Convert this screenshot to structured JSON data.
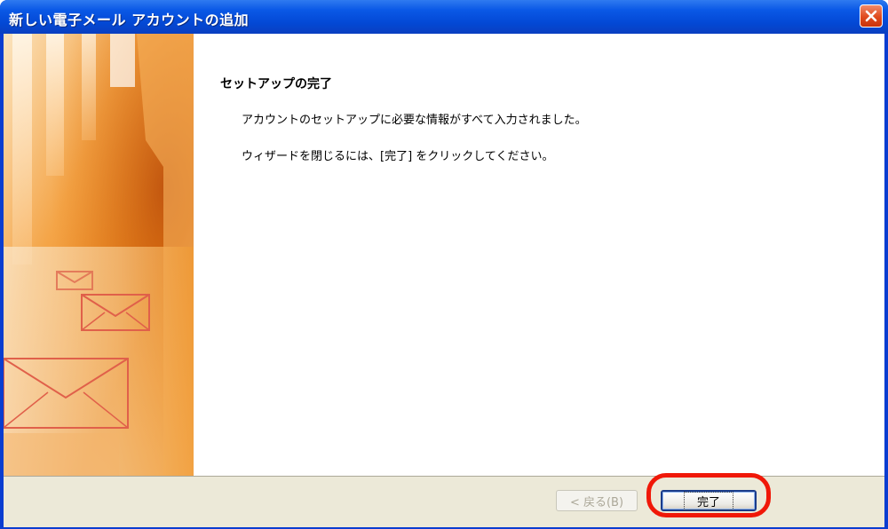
{
  "window": {
    "title": "新しい電子メール アカウントの追加",
    "title_bar_color": "#0a58e6",
    "close_icon": "close-icon"
  },
  "content": {
    "heading": "セットアップの完了",
    "message_line1": "アカウントのセットアップに必要な情報がすべて入力されました。",
    "message_line2": "ウィザードを閉じるには、[完了] をクリックしてください。"
  },
  "buttons": {
    "back_label": "< 戻る(B)",
    "back_enabled": false,
    "finish_label": "完了"
  },
  "annotation": {
    "highlight_color": "#f01808"
  },
  "banner": {
    "theme_color": "#f3a13c",
    "icon_names": [
      "envelope-icon",
      "envelope-icon",
      "envelope-icon"
    ]
  }
}
